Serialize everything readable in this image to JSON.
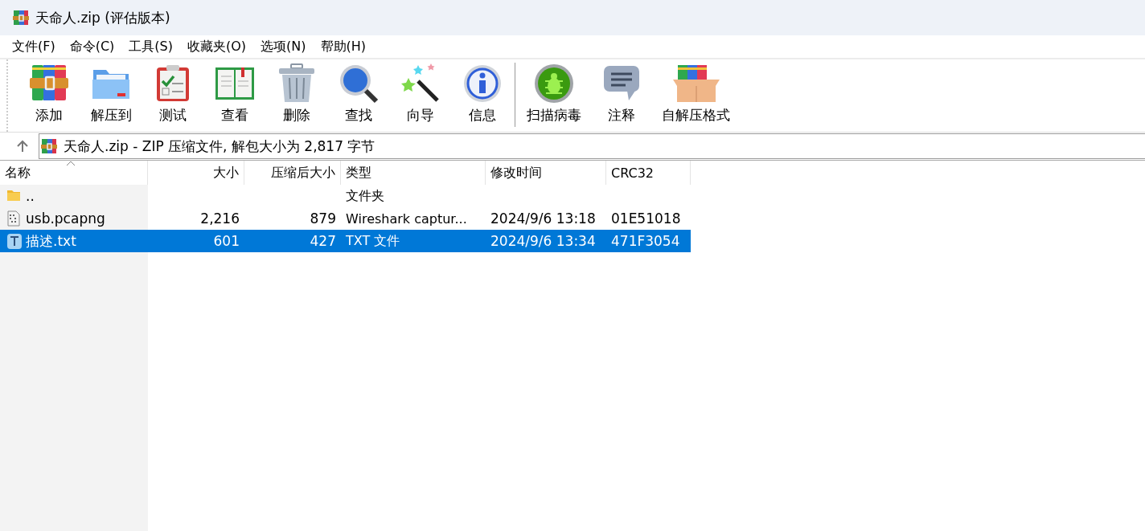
{
  "window": {
    "title": "天命人.zip (评估版本)"
  },
  "menu": [
    "文件(F)",
    "命令(C)",
    "工具(S)",
    "收藏夹(O)",
    "选项(N)",
    "帮助(H)"
  ],
  "toolbar": [
    {
      "label": "添加",
      "kind": "archive"
    },
    {
      "label": "解压到",
      "kind": "folder"
    },
    {
      "label": "测试",
      "kind": "clipboard"
    },
    {
      "label": "查看",
      "kind": "book"
    },
    {
      "label": "删除",
      "kind": "trash"
    },
    {
      "label": "查找",
      "kind": "magnifier"
    },
    {
      "label": "向导",
      "kind": "wand"
    },
    {
      "label": "信息",
      "kind": "info"
    },
    {
      "label": "扫描病毒",
      "kind": "bug",
      "separator_before": true
    },
    {
      "label": "注释",
      "kind": "comment"
    },
    {
      "label": "自解压格式",
      "kind": "box"
    }
  ],
  "address": {
    "text": "天命人.zip - ZIP 压缩文件, 解包大小为 2,817 字节"
  },
  "table": {
    "columns": [
      {
        "label": "名称",
        "sorted": true
      },
      {
        "label": "大小",
        "sorted": false
      },
      {
        "label": "压缩后大小",
        "sorted": false
      },
      {
        "label": "类型",
        "sorted": false
      },
      {
        "label": "修改时间",
        "sorted": false
      },
      {
        "label": "CRC32",
        "sorted": false
      }
    ],
    "rows": [
      {
        "kind": "folder",
        "name": "..",
        "size": "",
        "packed": "",
        "type": "文件夹",
        "modified": "",
        "crc": "",
        "selected": false
      },
      {
        "kind": "binary",
        "name": "usb.pcapng",
        "size": "2,216",
        "packed": "879",
        "type": "Wireshark captur...",
        "modified": "2024/9/6 13:18",
        "crc": "01E51018",
        "selected": false
      },
      {
        "kind": "text",
        "name": "描述.txt",
        "size": "601",
        "packed": "427",
        "type": "TXT 文件",
        "modified": "2024/9/6 13:34",
        "crc": "471F3054",
        "selected": true
      }
    ]
  }
}
